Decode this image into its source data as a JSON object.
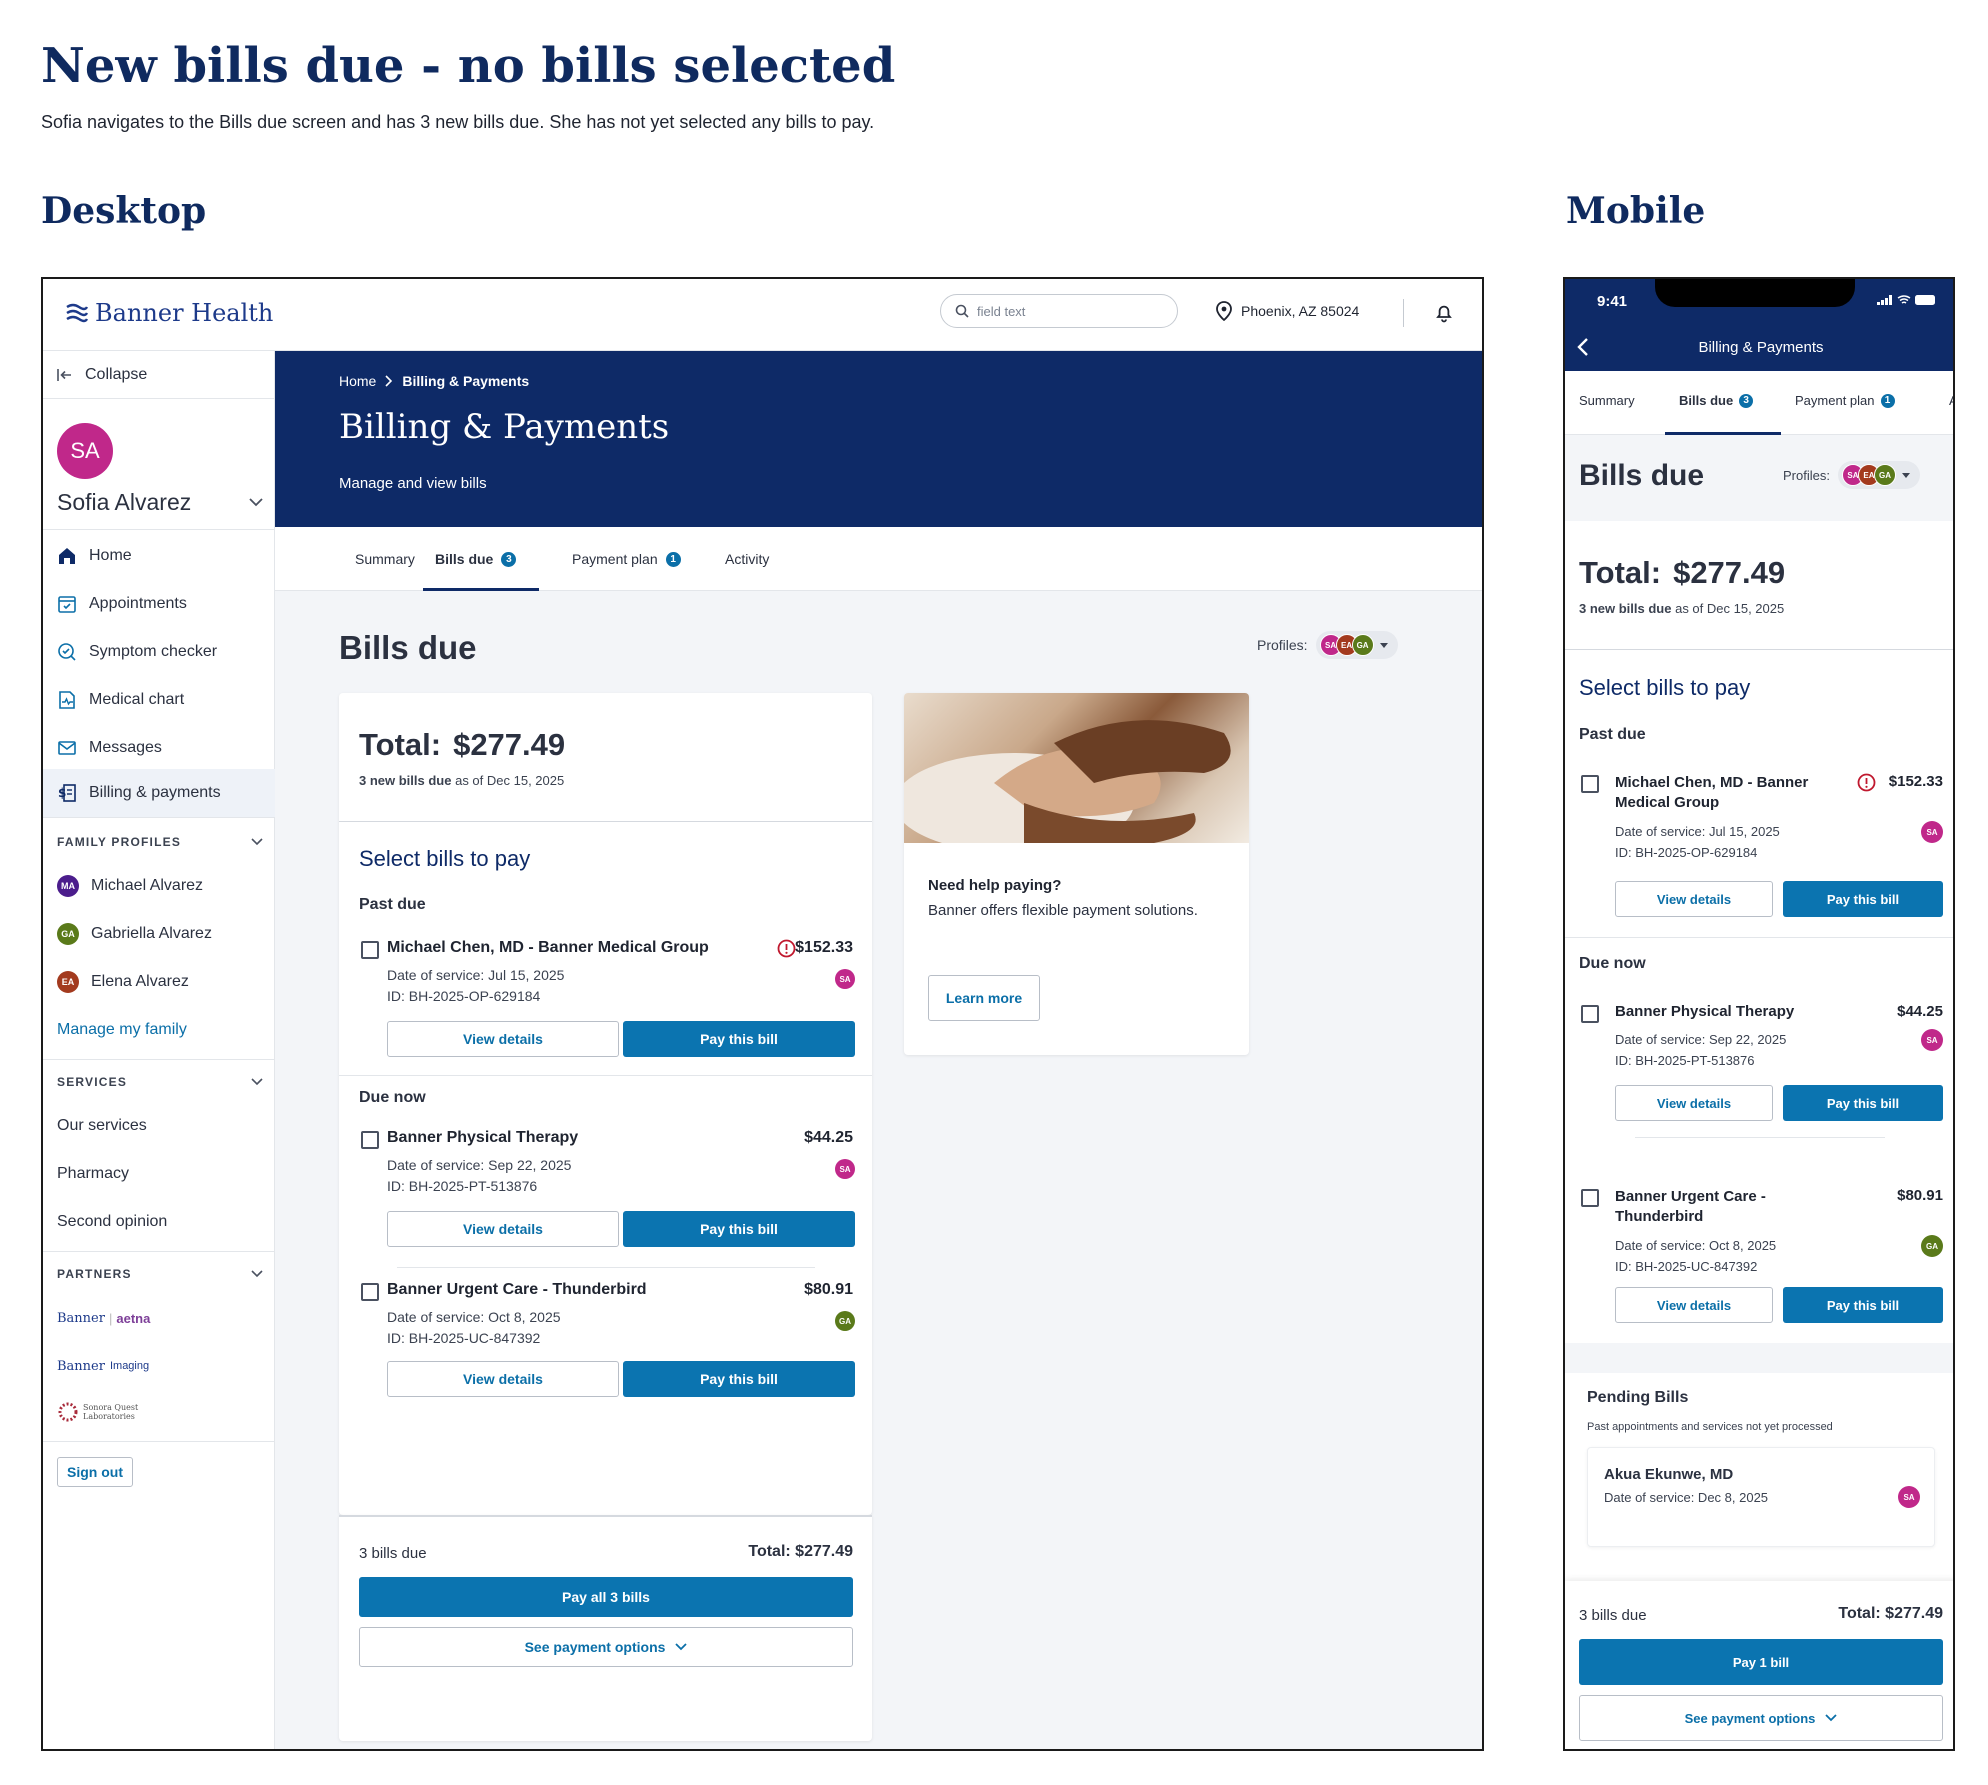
{
  "page": {
    "title": "New bills due - no bills selected",
    "subtitle": "Sofia navigates to the Bills due screen and has 3 new bills due. She has not yet selected any bills to pay.",
    "desktop_label": "Desktop",
    "mobile_label": "Mobile"
  },
  "header": {
    "logo": "Banner Health",
    "search_placeholder": "field text",
    "location": "Phoenix, AZ 85024"
  },
  "sidebar": {
    "collapse": "Collapse",
    "user_initials": "SA",
    "user_name": "Sofia Alvarez",
    "nav": [
      {
        "label": "Home",
        "icon": "home-icon"
      },
      {
        "label": "Appointments",
        "icon": "calendar-icon"
      },
      {
        "label": "Symptom checker",
        "icon": "symptom-checker-icon"
      },
      {
        "label": "Medical chart",
        "icon": "medical-chart-icon"
      },
      {
        "label": "Messages",
        "icon": "mail-icon"
      },
      {
        "label": "Billing & payments",
        "icon": "billing-icon"
      }
    ],
    "family_heading": "FAMILY PROFILES",
    "family": [
      {
        "initials": "MA",
        "name": "Michael Alvarez",
        "color": "#4b1d8c"
      },
      {
        "initials": "GA",
        "name": "Gabriella Alvarez",
        "color": "#5a7a1a"
      },
      {
        "initials": "EA",
        "name": "Elena Alvarez",
        "color": "#a33a1e"
      }
    ],
    "manage_family": "Manage my family",
    "services_heading": "SERVICES",
    "services": [
      "Our services",
      "Pharmacy",
      "Second opinion"
    ],
    "partners_heading": "PARTNERS",
    "partners": {
      "banner": "Banner",
      "aetna": "aetna",
      "imaging": "Imaging",
      "sonora_1": "Sonora Quest",
      "sonora_2": "Laboratories"
    },
    "sign_out": "Sign out"
  },
  "hero": {
    "breadcrumb_home": "Home",
    "breadcrumb_current": "Billing & Payments",
    "title": "Billing & Payments",
    "subtitle": "Manage and view bills"
  },
  "tabs": [
    {
      "label": "Summary",
      "badge": ""
    },
    {
      "label": "Bills due",
      "badge": "3"
    },
    {
      "label": "Payment plan",
      "badge": "1"
    },
    {
      "label": "Activity",
      "badge": ""
    }
  ],
  "bills_page": {
    "title": "Bills due",
    "profiles_label": "Profiles:",
    "profile_avatars": [
      {
        "initials": "SA",
        "color": "#c0288a"
      },
      {
        "initials": "EA",
        "color": "#a33a1e"
      },
      {
        "initials": "GA",
        "color": "#5a7a1a"
      }
    ],
    "total_label": "Total:",
    "total_amount": "$277.49",
    "new_bills_bold": "3 new bills due",
    "as_of": "as of Dec 15, 2025",
    "select_heading": "Select bills to pay",
    "past_due_heading": "Past due",
    "due_now_heading": "Due now",
    "date_label": "Date of service:",
    "id_label": "ID:",
    "view_details": "View details",
    "pay_this_bill": "Pay this bill",
    "bills": [
      {
        "name": "Michael Chen, MD - Banner Medical Group",
        "mobile_name_1": "Michael Chen, MD - Banner",
        "mobile_name_2": "Medical Group",
        "amount": "$152.33",
        "date": "Jul 15, 2025",
        "id": "BH-2025-OP-629184",
        "patient": "SA",
        "patient_color": "#c0288a",
        "alert": true
      },
      {
        "name": "Banner Physical Therapy",
        "mobile_name_1": "Banner Physical Therapy",
        "mobile_name_2": "",
        "amount": "$44.25",
        "date": "Sep 22, 2025",
        "id": "BH-2025-PT-513876",
        "patient": "SA",
        "patient_color": "#c0288a",
        "alert": false
      },
      {
        "name": "Banner Urgent Care - Thunderbird",
        "mobile_name_1": "Banner Urgent Care -",
        "mobile_name_2": "Thunderbird",
        "amount": "$80.91",
        "date": "Oct 8, 2025",
        "id": "BH-2025-UC-847392",
        "patient": "GA",
        "patient_color": "#5a7a1a",
        "alert": false
      }
    ],
    "footer_count": "3 bills due",
    "footer_total": "Total: $277.49",
    "pay_all": "Pay all 3 bills",
    "see_options": "See payment options"
  },
  "help_card": {
    "title": "Need help paying?",
    "body": "Banner offers flexible payment solutions.",
    "button": "Learn more"
  },
  "mobile": {
    "time": "9:41",
    "header_title": "Billing & Payments",
    "tabs": [
      {
        "label": "Summary",
        "badge": ""
      },
      {
        "label": "Bills due",
        "badge": "3"
      },
      {
        "label": "Payment plan",
        "badge": "1"
      },
      {
        "label": "A",
        "badge": ""
      }
    ],
    "pending_title": "Pending Bills",
    "pending_sub": "Past appointments and services not yet processed",
    "pending_name": "Akua Ekunwe, MD",
    "pending_date_partial": "Date of service: Dec 8, 2025",
    "pay_button": "Pay 1 bill"
  },
  "colors": {
    "navy": "#0e2a67",
    "primary": "#0b74b0",
    "alert": "#c0182e"
  }
}
